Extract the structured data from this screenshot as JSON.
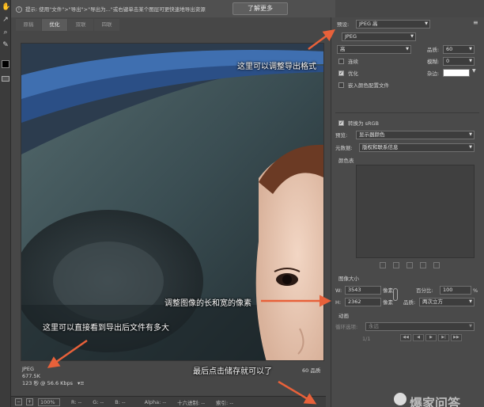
{
  "topbar": {
    "hint": "提示: 使用\"文件\">\"导出\">\"导出为...\"或右键单击某个图层可更快速地导出资源",
    "learn_more": "了解更多"
  },
  "tabs": [
    {
      "label": "原稿",
      "active": false
    },
    {
      "label": "优化",
      "active": true
    },
    {
      "label": "双联",
      "active": false
    },
    {
      "label": "四联",
      "active": false
    }
  ],
  "fileinfo": {
    "format": "JPEG",
    "size": "677.5K",
    "rate": "123 秒 @ 56.6 Kbps"
  },
  "quality_label": "60 品质",
  "statusbar": {
    "zoom": "100%",
    "r": "R: --",
    "g": "G: --",
    "b": "B: --",
    "alpha": "Alpha: --",
    "hex": "十六进制: --",
    "index": "索引: --"
  },
  "settings": {
    "preset_label": "预设:",
    "preset_value": "JPEG 高",
    "format_value": "JPEG",
    "quality_level": "高",
    "quality_label": "品质:",
    "quality_value": "60",
    "progressive_label": "连续",
    "blur_label": "模糊:",
    "blur_value": "0",
    "optimized_label": "优化",
    "matte_label": "杂边:",
    "embed_profile_label": "嵌入颜色配置文件",
    "convert_srgb_label": "转换为 sRGB",
    "preview_label": "预览:",
    "preview_value": "显示器颜色",
    "metadata_label": "元数据:",
    "metadata_value": "版权和联系信息",
    "color_table_label": "颜色表"
  },
  "image_size": {
    "title": "图像大小",
    "w_label": "W:",
    "w_value": "3543",
    "h_label": "H:",
    "h_value": "2362",
    "unit": "像素",
    "percent_label": "百分比:",
    "percent_value": "100",
    "percent_sign": "%",
    "quality_label": "品质:",
    "quality_value": "两次立方"
  },
  "animation": {
    "title": "动画",
    "loop_label": "循环选项:",
    "loop_value": "永远",
    "frame": "1/1"
  },
  "annotations": {
    "format": "这里可以调整导出格式",
    "size": "调整图像的长和宽的像素",
    "filesize": "这里可以直接看到导出后文件有多大",
    "save": "最后点击储存就可以了"
  },
  "watermark": "爆家问答",
  "colors": {
    "arrow": "#e8613a",
    "panel": "#4a4a4a",
    "bg": "#474747"
  }
}
